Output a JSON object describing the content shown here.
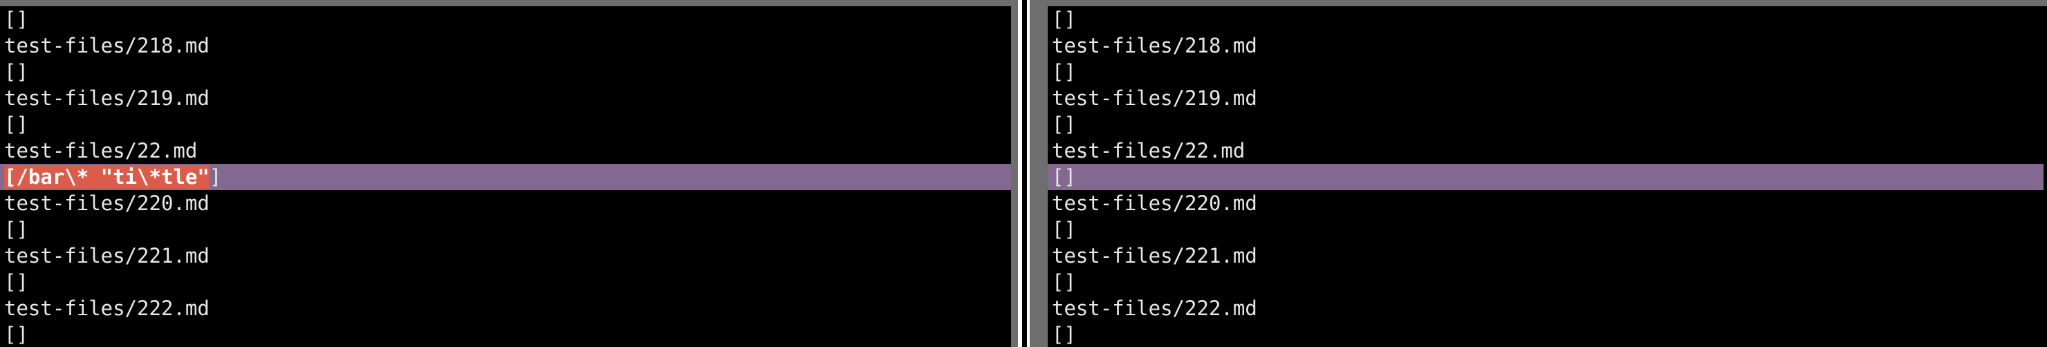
{
  "left_pane": {
    "lines": [
      "[]",
      "test-files/218.md",
      "[]",
      "test-files/219.md",
      "[]",
      "test-files/22.md",
      "[/bar\\* \"ti\\*tle\"]",
      "test-files/220.md",
      "[]",
      "test-files/221.md",
      "[]",
      "test-files/222.md",
      "[]"
    ],
    "highlight": {
      "open": "[",
      "changed": "/bar\\* \"ti\\*tle\"",
      "close": "]"
    }
  },
  "right_pane": {
    "lines": [
      "[]",
      "test-files/218.md",
      "[]",
      "test-files/219.md",
      "[]",
      "test-files/22.md",
      "[]",
      "test-files/220.md",
      "[]",
      "test-files/221.md",
      "[]",
      "test-files/222.md",
      "[]"
    ]
  },
  "colors": {
    "changed_line_bg": "#83688f",
    "changed_text_bg": "#dc5c4c",
    "border_gray": "#6e6e6e"
  }
}
